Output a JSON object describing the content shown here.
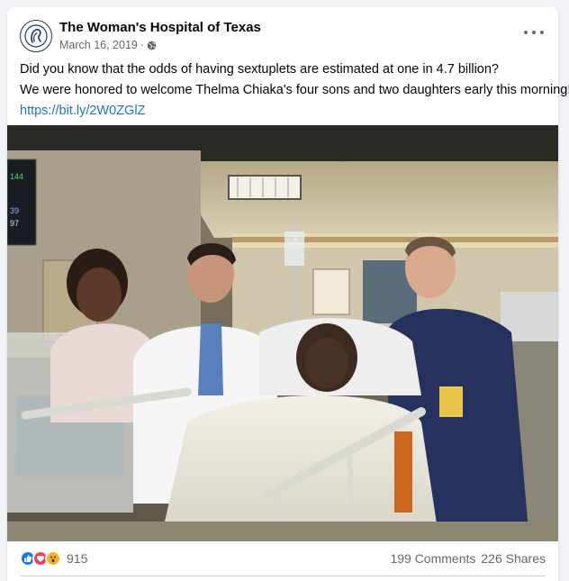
{
  "post": {
    "page_name": "The Woman's Hospital of Texas",
    "date": "March 16, 2019",
    "separator": "·",
    "privacy_icon": "globe-icon",
    "avatar_icon": "hospital-logo-icon",
    "more_icon": "more-options-icon",
    "text_line_1": "Did you know that the odds of having sextuplets are estimated at one in 4.7 billion?",
    "text_line_2": "We were honored to welcome Thelma Chiaka's four sons and two daughters early this morning!",
    "link": "https://bit.ly/2W0ZGlZ"
  },
  "photo": {
    "monitor_values": [
      "144",
      "39",
      "97"
    ]
  },
  "footer": {
    "reaction_icons": [
      "like-icon",
      "love-icon",
      "wow-icon"
    ],
    "reaction_count": "915",
    "comments": "199 Comments",
    "shares": "226 Shares"
  },
  "colors": {
    "link": "#216fdb",
    "like": "#1877f2",
    "love": "#f33e58",
    "wow": "#f7b125",
    "secondary_text": "#65676b"
  }
}
